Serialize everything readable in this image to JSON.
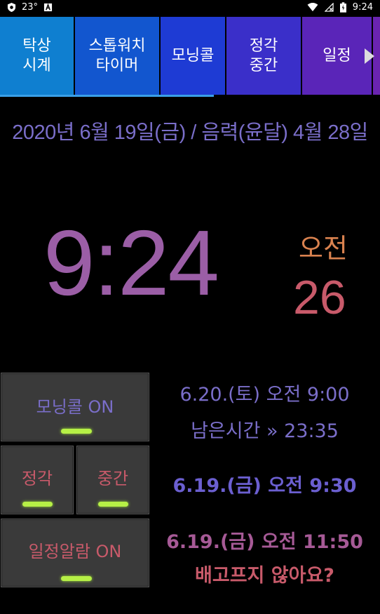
{
  "status_bar": {
    "temperature": "23°",
    "time": "9:24"
  },
  "tabs": [
    {
      "label": "탁상\n시계",
      "color": "#0f7fd0"
    },
    {
      "label": "스톱워치\n타이머",
      "color": "#1256cf"
    },
    {
      "label": "모닝콜",
      "color": "#1e3bd4"
    },
    {
      "label": "정각\n중간",
      "color": "#3a2fc9"
    },
    {
      "label": "일정",
      "color": "#5a25b8"
    }
  ],
  "date_line": "2020년 6월 19일(금)  / 음력(윤달) 4월 28일",
  "clock": {
    "time": "9:24",
    "ampm": "오전",
    "seconds": "26"
  },
  "buttons": {
    "morning_call": "모닝콜 ON",
    "on_the_hour": "정각",
    "half_hour": "중간",
    "schedule_alarm": "일정알람 ON"
  },
  "info": {
    "morning_call_time": "6.20.(토) 오전 9:00",
    "remaining": "남은시간 » 23:35",
    "hourly_next": "6.19.(금) 오전 9:30",
    "schedule_time": "6.19.(금) 오전 11:50",
    "schedule_text": "배고프지 않아요?"
  },
  "colors": {
    "accent_purple": "#7a6ec9",
    "time_purple": "#9b5ea6",
    "ampm_orange": "#d9824f",
    "seconds_red": "#c85a6a",
    "led_green": "#b6f046"
  }
}
